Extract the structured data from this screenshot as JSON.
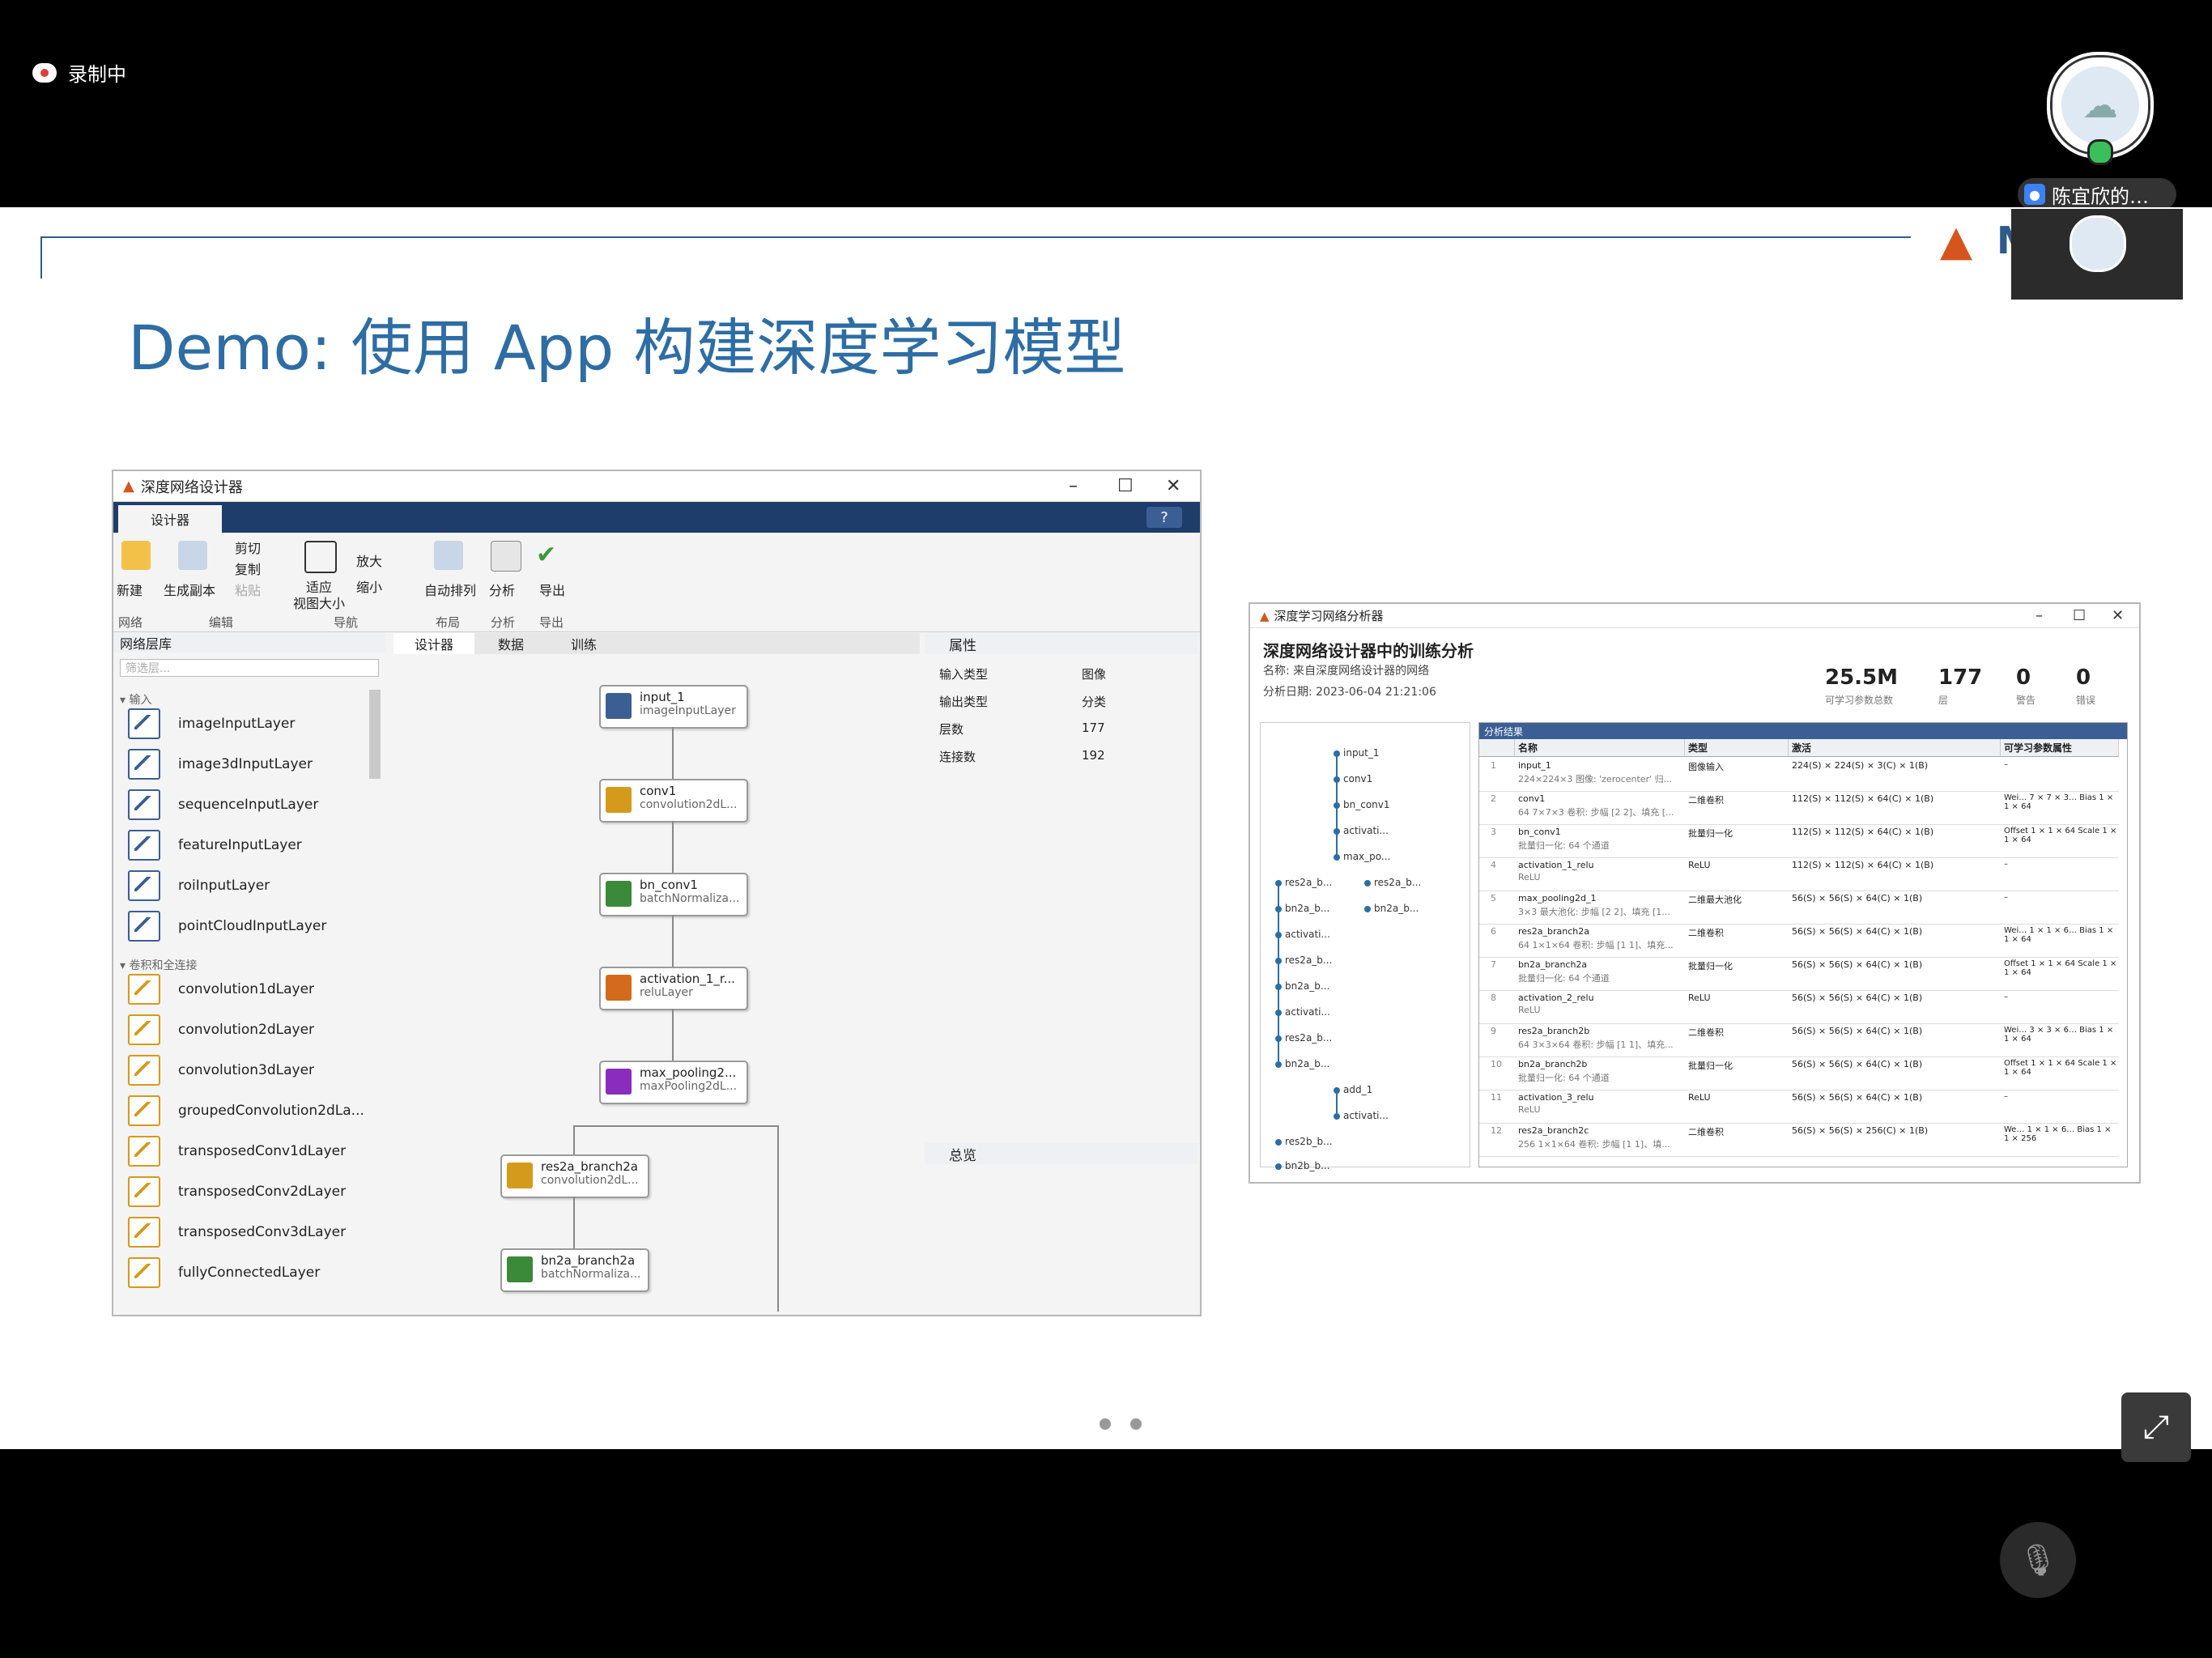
{
  "top": {
    "recording_label": "录制中",
    "participant_name": "陈宜欣的…"
  },
  "slide": {
    "title": "Demo: 使用 App 构建深度学习模型",
    "logo_letter": "M"
  },
  "designer": {
    "window_title": "深度网络设计器",
    "ribbon_tab": "设计器",
    "buttons": {
      "new": "新建",
      "duplicate": "生成副本",
      "cut": "剪切",
      "copy": "复制",
      "paste": "粘贴",
      "fit": "适应\n视图大小",
      "zoom_in": "放大",
      "zoom_out": "缩小",
      "auto_arrange": "自动排列",
      "analyze": "分析",
      "export": "导出"
    },
    "groups": {
      "network": "网络",
      "edit": "编辑",
      "navigate": "导航",
      "layout": "布局",
      "analysis": "分析",
      "export": "导出"
    },
    "library": {
      "title": "网络层库",
      "search_placeholder": "筛选层...",
      "cat_input": "输入",
      "cat_conv": "卷积和全连接",
      "input_items": [
        "imageInputLayer",
        "image3dInputLayer",
        "sequenceInputLayer",
        "featureInputLayer",
        "roiInputLayer",
        "pointCloudInputLayer"
      ],
      "conv_items": [
        "convolution1dLayer",
        "convolution2dLayer",
        "convolution3dLayer",
        "groupedConvolution2dLa...",
        "transposedConv1dLayer",
        "transposedConv2dLayer",
        "transposedConv3dLayer",
        "fullyConnectedLayer"
      ]
    },
    "canvas_tabs": [
      "设计器",
      "数据",
      "训练"
    ],
    "nodes": [
      {
        "name": "input_1",
        "type": "imageInputLayer",
        "color": "#3b5f94"
      },
      {
        "name": "conv1",
        "type": "convolution2dL...",
        "color": "#d49a1c"
      },
      {
        "name": "bn_conv1",
        "type": "batchNormaliza...",
        "color": "#3a8a3a"
      },
      {
        "name": "activation_1_r...",
        "type": "reluLayer",
        "color": "#d46a1c"
      },
      {
        "name": "max_pooling2...",
        "type": "maxPooling2dL...",
        "color": "#8a2dbf"
      },
      {
        "name": "res2a_branch2a",
        "type": "convolution2dL...",
        "color": "#d49a1c"
      },
      {
        "name": "bn2a_branch2a",
        "type": "batchNormaliza...",
        "color": "#3a8a3a"
      }
    ],
    "props": {
      "title": "属性",
      "rows": [
        {
          "label": "输入类型",
          "value": "图像"
        },
        {
          "label": "输出类型",
          "value": "分类"
        },
        {
          "label": "层数",
          "value": "177"
        },
        {
          "label": "连接数",
          "value": "192"
        }
      ],
      "overview": "总览"
    }
  },
  "analyzer": {
    "window_title": "深度学习网络分析器",
    "title": "深度网络设计器中的训练分析",
    "name_line": "名称: 来自深度网络设计器的网络",
    "date_line": "分析日期: 2023-06-04 21:21:06",
    "stats": [
      {
        "value": "25.5M",
        "label": "可学习参数总数"
      },
      {
        "value": "177",
        "label": "层"
      },
      {
        "value": "0",
        "label": "警告"
      },
      {
        "value": "0",
        "label": "错误"
      }
    ],
    "graph_nodes": [
      "input_1",
      "conv1",
      "bn_conv1",
      "activati...",
      "max_po...",
      "res2a_b...",
      "res2a_b...",
      "bn2a_b...",
      "bn2a_b...",
      "activati...",
      "res2a_b...",
      "bn2a_b...",
      "activati...",
      "res2a_b...",
      "bn2a_b...",
      "add_1",
      "activati...",
      "res2b_b...",
      "bn2b_b..."
    ],
    "table_title": "分析结果",
    "columns": [
      "名称",
      "类型",
      "激活",
      "可学习参数属性"
    ],
    "rows": [
      {
        "n": "1",
        "name": "input_1",
        "sub": "224×224×3 图像: 'zerocenter' 归...",
        "type": "图像输入",
        "act": "224(S) × 224(S) × 3(C) × 1(B)",
        "learn": "–"
      },
      {
        "n": "2",
        "name": "conv1",
        "sub": "64 7×7×3 卷积: 步幅 [2 2]、填充 [...",
        "type": "二维卷积",
        "act": "112(S) × 112(S) × 64(C) × 1(B)",
        "learn": "Wei… 7 × 7 × 3…  Bias 1 × 1 × 64"
      },
      {
        "n": "3",
        "name": "bn_conv1",
        "sub": "批量归一化: 64 个通道",
        "type": "批量归一化",
        "act": "112(S) × 112(S) × 64(C) × 1(B)",
        "learn": "Offset 1 × 1 × 64  Scale 1 × 1 × 64"
      },
      {
        "n": "4",
        "name": "activation_1_relu",
        "sub": "ReLU",
        "type": "ReLU",
        "act": "112(S) × 112(S) × 64(C) × 1(B)",
        "learn": "–"
      },
      {
        "n": "5",
        "name": "max_pooling2d_1",
        "sub": "3×3 最大池化: 步幅 [2 2]、填充 [1...",
        "type": "二维最大池化",
        "act": "56(S) × 56(S) × 64(C) × 1(B)",
        "learn": "–"
      },
      {
        "n": "6",
        "name": "res2a_branch2a",
        "sub": "64 1×1×64 卷积: 步幅 [1 1]、填充...",
        "type": "二维卷积",
        "act": "56(S) × 56(S) × 64(C) × 1(B)",
        "learn": "Wei… 1 × 1 × 6…  Bias 1 × 1 × 64"
      },
      {
        "n": "7",
        "name": "bn2a_branch2a",
        "sub": "批量归一化: 64 个通道",
        "type": "批量归一化",
        "act": "56(S) × 56(S) × 64(C) × 1(B)",
        "learn": "Offset 1 × 1 × 64  Scale 1 × 1 × 64"
      },
      {
        "n": "8",
        "name": "activation_2_relu",
        "sub": "ReLU",
        "type": "ReLU",
        "act": "56(S) × 56(S) × 64(C) × 1(B)",
        "learn": "–"
      },
      {
        "n": "9",
        "name": "res2a_branch2b",
        "sub": "64 3×3×64 卷积: 步幅 [1 1]、填充...",
        "type": "二维卷积",
        "act": "56(S) × 56(S) × 64(C) × 1(B)",
        "learn": "Wei… 3 × 3 × 6…  Bias 1 × 1 × 64"
      },
      {
        "n": "10",
        "name": "bn2a_branch2b",
        "sub": "批量归一化: 64 个通道",
        "type": "批量归一化",
        "act": "56(S) × 56(S) × 64(C) × 1(B)",
        "learn": "Offset 1 × 1 × 64  Scale 1 × 1 × 64"
      },
      {
        "n": "11",
        "name": "activation_3_relu",
        "sub": "ReLU",
        "type": "ReLU",
        "act": "56(S) × 56(S) × 64(C) × 1(B)",
        "learn": "–"
      },
      {
        "n": "12",
        "name": "res2a_branch2c",
        "sub": "256 1×1×64 卷积: 步幅 [1 1]、填...",
        "type": "二维卷积",
        "act": "56(S) × 56(S) × 256(C) × 1(B)",
        "learn": "We… 1 × 1 × 6…  Bias 1 × 1 × 256"
      }
    ]
  }
}
